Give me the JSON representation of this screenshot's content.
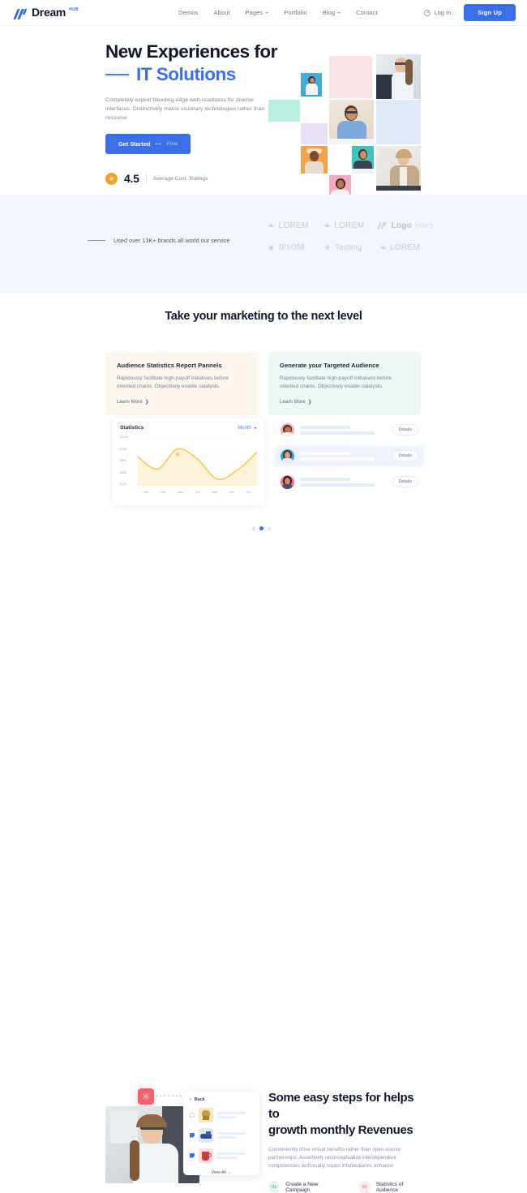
{
  "header": {
    "logo_text": "Dream",
    "logo_sup": "HUB",
    "nav": [
      {
        "label": "Demos",
        "caret": false
      },
      {
        "label": "About",
        "caret": false
      },
      {
        "label": "Pages",
        "caret": true
      },
      {
        "label": "Portfolio",
        "caret": false
      },
      {
        "label": "Blog",
        "caret": true
      },
      {
        "label": "Contact",
        "caret": false
      }
    ],
    "login_label": "Log In",
    "signup_label": "Sign Up"
  },
  "hero": {
    "title_line1": "New Experiences for",
    "title_line2": "IT Solutions",
    "subtitle": "Completely exploit bleeding-edge web-readiness for diverse interfaces. Distinctively matrix visionary technologies rather than resource",
    "cta_label": "Get Started",
    "cta_sub": "Free",
    "rating_value": "4.5",
    "rating_label": "Average Cust. Ratings",
    "star_glyph": "★"
  },
  "brands": {
    "tagline": "Used over 13K+ brands all world our service",
    "items": [
      {
        "label": "LOREM",
        "icon": "leaf-mark-icon",
        "split": false
      },
      {
        "label": "LOREM",
        "icon": "leaf-mark-icon",
        "split": false
      },
      {
        "label_a": "Logo",
        "label_b": "Here",
        "icon": "slash-mark-icon",
        "split": true
      },
      {
        "label": "IPSOM",
        "icon": "bird-mark-icon",
        "split": false
      },
      {
        "label": "Testing",
        "icon": "tulip-mark-icon",
        "split": false
      },
      {
        "label": "LOREM",
        "icon": "leaf-mark-icon",
        "split": false
      }
    ]
  },
  "marketing": {
    "title": "Take your marketing to the next level",
    "cards": [
      {
        "heading": "Audience Statistics Report Pannels",
        "body": "Rapidously facilitate high-payoff initiatives before oriented chains. Objectively enable catalysts.",
        "link": "Learn More",
        "link_arrow": "❯"
      },
      {
        "heading": "Generate your Targeted Audience",
        "body": "Rapidously facilitate high-payoff initiatives before oriented chains. Objectively enable catalysts.",
        "link": "Learn More",
        "link_arrow": "❯"
      }
    ],
    "list_rows": [
      {
        "details_label": "Details",
        "active": false
      },
      {
        "details_label": "Details",
        "active": true
      },
      {
        "details_label": "Details",
        "active": false
      }
    ],
    "carousel_dots": 3,
    "carousel_active_index": 1
  },
  "chart_data": {
    "type": "area",
    "title": "Statistics",
    "range_selector": "Month",
    "xlabel": "",
    "ylabel": "",
    "categories": [
      "Jan",
      "Feb",
      "Marc",
      "Apr",
      "May",
      "Jun",
      "July"
    ],
    "ytick_labels": [
      "$100K",
      "$75K",
      "$50K",
      "$30K",
      "$10K"
    ],
    "ylim": [
      10,
      100
    ],
    "values": [
      62,
      40,
      76,
      58,
      22,
      38,
      70
    ],
    "highlight_point": {
      "x": "Marc",
      "y": 66
    },
    "line_color": "#f5c343",
    "fill_color": "#fdf3d8",
    "grid": true,
    "legend": "none"
  },
  "steps": {
    "title_line1": "Some easy steps for helps to",
    "title_line2": "growth monthly Revenues",
    "body": "Conveniently drive virtual benefits rather than open-source partnerships. Assertively reconceptualize interdependent competencies technically sound infomediaries enhance",
    "items": [
      {
        "num": "01",
        "label": "Create a New Campaign"
      },
      {
        "num": "02",
        "label": "Statistics of Audience"
      }
    ],
    "mock": {
      "back_label": "Back",
      "back_icon": "chevron-left-icon",
      "gear_icon": "gear-icon",
      "view_all": "View All",
      "view_all_arrow": "→",
      "rows": [
        {
          "checked": false,
          "thumb": "chair-thumb"
        },
        {
          "checked": true,
          "thumb": "shoe-thumb"
        },
        {
          "checked": true,
          "thumb": "mug-thumb"
        }
      ]
    }
  },
  "colors": {
    "primary": "#3b6fe8",
    "accent_orange": "#f6a028",
    "accent_red": "#f4616c",
    "chart_yellow": "#f5c343",
    "band_bg": "#f3f7fd"
  }
}
